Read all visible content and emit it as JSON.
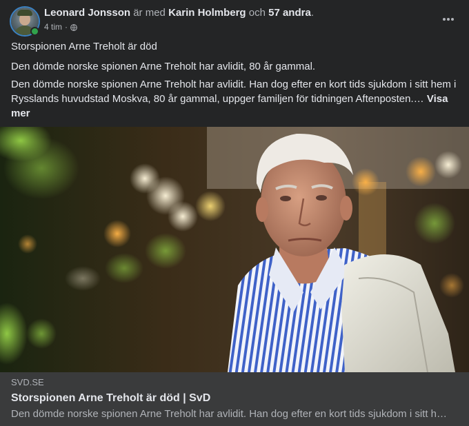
{
  "post": {
    "author": "Leonard Jonsson",
    "with_text": "är med",
    "tagged_person": "Karin Holmberg",
    "and_text": "och",
    "others": "57 andra",
    "period": ".",
    "time": "4 tim",
    "dot": "·",
    "privacy_icon": "globe-icon",
    "more_icon": "three-dots-icon",
    "text": {
      "line1": "Storspionen Arne Treholt är död",
      "line2": "Den dömde norske spionen Arne Treholt har avlidit, 80 år gammal.",
      "line3": "Den dömde norske spionen Arne Treholt har avlidit. Han dog efter en kort tids sjukdom i sitt hem i Rysslands huvudstad Moskva, 80 år gammal, uppger familjen för tidningen Aftenposten.…",
      "see_more": "Visa mer"
    }
  },
  "link_preview": {
    "domain": "SVD.SE",
    "title": "Storspionen Arne Treholt är död | SvD",
    "description": "Den dömde norske spionen Arne Treholt har avlidit. Han dog efter en kort tids sjukdom i sitt hem i Rysslands huvudstad Moskva, 80 år gammal, uppger familjen för tidningen Aftenposten."
  },
  "colors": {
    "card_bg": "#242526",
    "link_bg": "#3a3b3c",
    "primary_text": "#e4e6eb",
    "secondary_text": "#b0b3b8",
    "online": "#31a24c"
  }
}
